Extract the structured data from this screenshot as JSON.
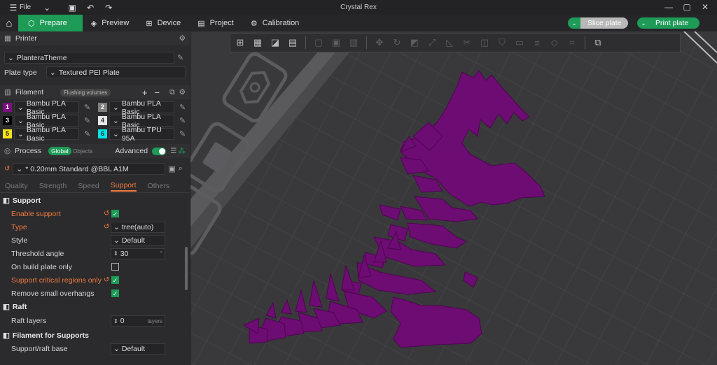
{
  "window": {
    "title": "Crystal Rex",
    "menu_label": "File"
  },
  "nav": {
    "tabs": [
      {
        "label": "Prepare",
        "icon": "cube-icon"
      },
      {
        "label": "Preview",
        "icon": "layers-icon"
      },
      {
        "label": "Device",
        "icon": "device-icon"
      },
      {
        "label": "Project",
        "icon": "project-icon"
      },
      {
        "label": "Calibration",
        "icon": "calibration-icon"
      }
    ],
    "slice_label": "Slice plate",
    "print_label": "Print plate"
  },
  "printer": {
    "section_label": "Printer",
    "preset": "PlanteraTheme",
    "plate_type_label": "Plate type",
    "plate_type": "Textured PEI Plate"
  },
  "filament": {
    "section_label": "Filament",
    "flushing_label": "Flushing volumes",
    "slots": [
      {
        "num": "1",
        "color": "#7b0f80",
        "text_color": "#ffffff",
        "name": "Bambu PLA Basic"
      },
      {
        "num": "2",
        "color": "#808080",
        "text_color": "#ffffff",
        "name": "Bambu PLA Basic"
      },
      {
        "num": "3",
        "color": "#000000",
        "text_color": "#ffffff",
        "name": "Bambu PLA Basic"
      },
      {
        "num": "4",
        "color": "#e8e8e8",
        "text_color": "#333333",
        "name": "Bambu PLA Basic"
      },
      {
        "num": "5",
        "color": "#f6e21c",
        "text_color": "#222222",
        "name": "Bambu PLA Basic"
      },
      {
        "num": "6",
        "color": "#00e5e5",
        "text_color": "#222222",
        "name": "Bambu TPU 95A"
      }
    ]
  },
  "process": {
    "section_label": "Process",
    "global_label": "Global",
    "objects_label": "Objects",
    "advanced_label": "Advanced",
    "preset": "* 0.20mm Standard @BBL A1M",
    "tabs": [
      "Quality",
      "Strength",
      "Speed",
      "Support",
      "Others"
    ],
    "active_tab": "Support"
  },
  "support": {
    "group_label": "Support",
    "enable_support": "Enable support",
    "type_label": "Type",
    "type_value": "tree(auto)",
    "style_label": "Style",
    "style_value": "Default",
    "threshold_label": "Threshold angle",
    "threshold_value": "30",
    "threshold_unit": "°",
    "build_plate_only": "On build plate only",
    "critical_regions": "Support critical regions only",
    "remove_small": "Remove small overhangs"
  },
  "raft": {
    "group_label": "Raft",
    "layers_label": "Raft layers",
    "layers_value": "0",
    "layers_unit": "layers"
  },
  "filament_supports": {
    "group_label": "Filament for Supports",
    "base_label": "Support/raft base",
    "base_value": "Default"
  },
  "colors": {
    "accent": "#1d9b57",
    "modified": "#f0793e",
    "model": "#7b0f80"
  }
}
